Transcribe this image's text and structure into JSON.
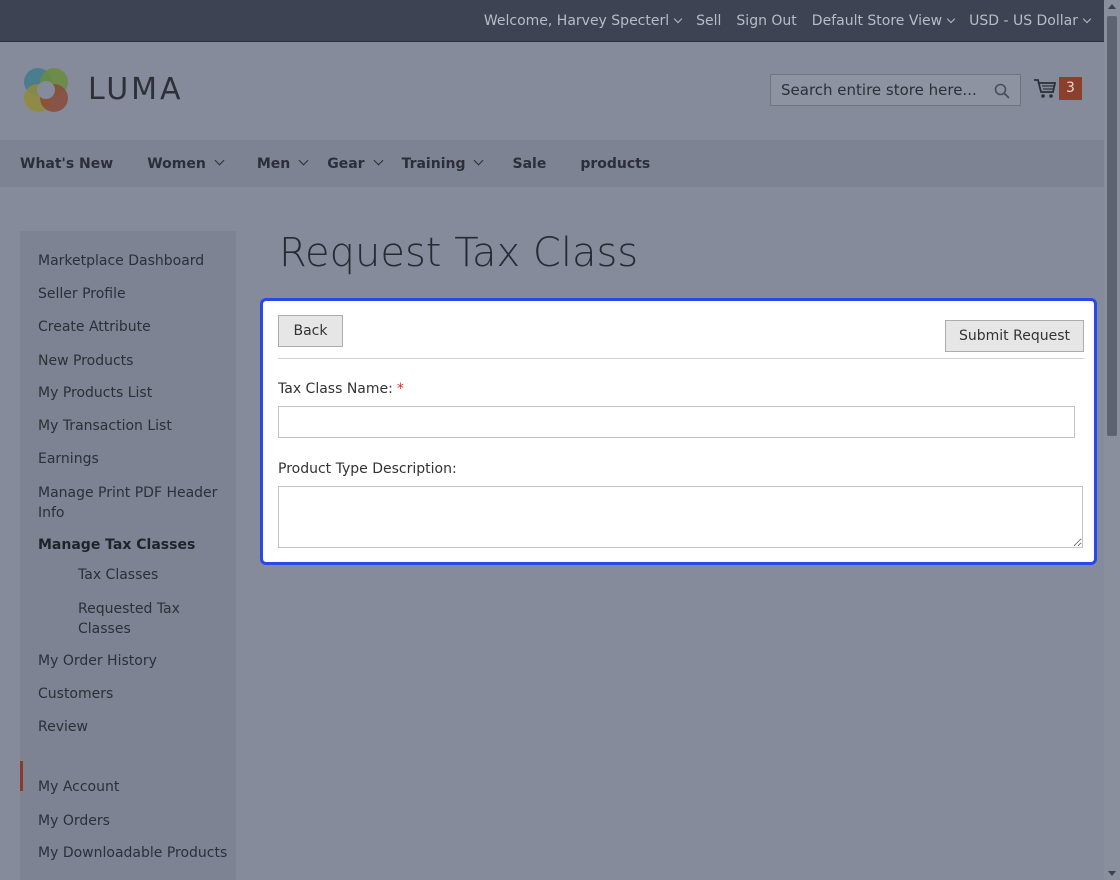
{
  "topbar": {
    "welcome": "Welcome, Harvey Specterl",
    "sell": "Sell",
    "sign_out": "Sign Out",
    "store_view": "Default Store View",
    "currency": "USD - US Dollar"
  },
  "header": {
    "logo_text": "LUMA",
    "search_placeholder": "Search entire store here...",
    "cart_count": "3"
  },
  "nav": {
    "items": [
      "What's New",
      "Women",
      "Men",
      "Gear",
      "Training",
      "Sale",
      "products"
    ]
  },
  "sidebar": {
    "items": [
      "Marketplace Dashboard",
      "Seller Profile",
      "Create Attribute",
      "New Products",
      "My Products List",
      "My Transaction List",
      "Earnings",
      "Manage Print PDF Header Info",
      "Manage Tax Classes",
      "My Order History",
      "Customers",
      "Review",
      "My Account",
      "My Orders",
      "My Downloadable Products"
    ],
    "sub_items": [
      "Tax Classes",
      "Requested Tax Classes"
    ]
  },
  "page": {
    "title": "Request Tax Class"
  },
  "form": {
    "back_label": "Back",
    "submit_label": "Submit Request",
    "tax_class_label": "Tax Class Name:",
    "required_mark": "*",
    "tax_class_value": "",
    "description_label": "Product Type Description:",
    "description_value": ""
  },
  "colors": {
    "panel_highlight": "#2848e8",
    "required": "#e02b27",
    "cart_badge": "#8b3f2d",
    "active_marker": "#8b3a2c"
  }
}
